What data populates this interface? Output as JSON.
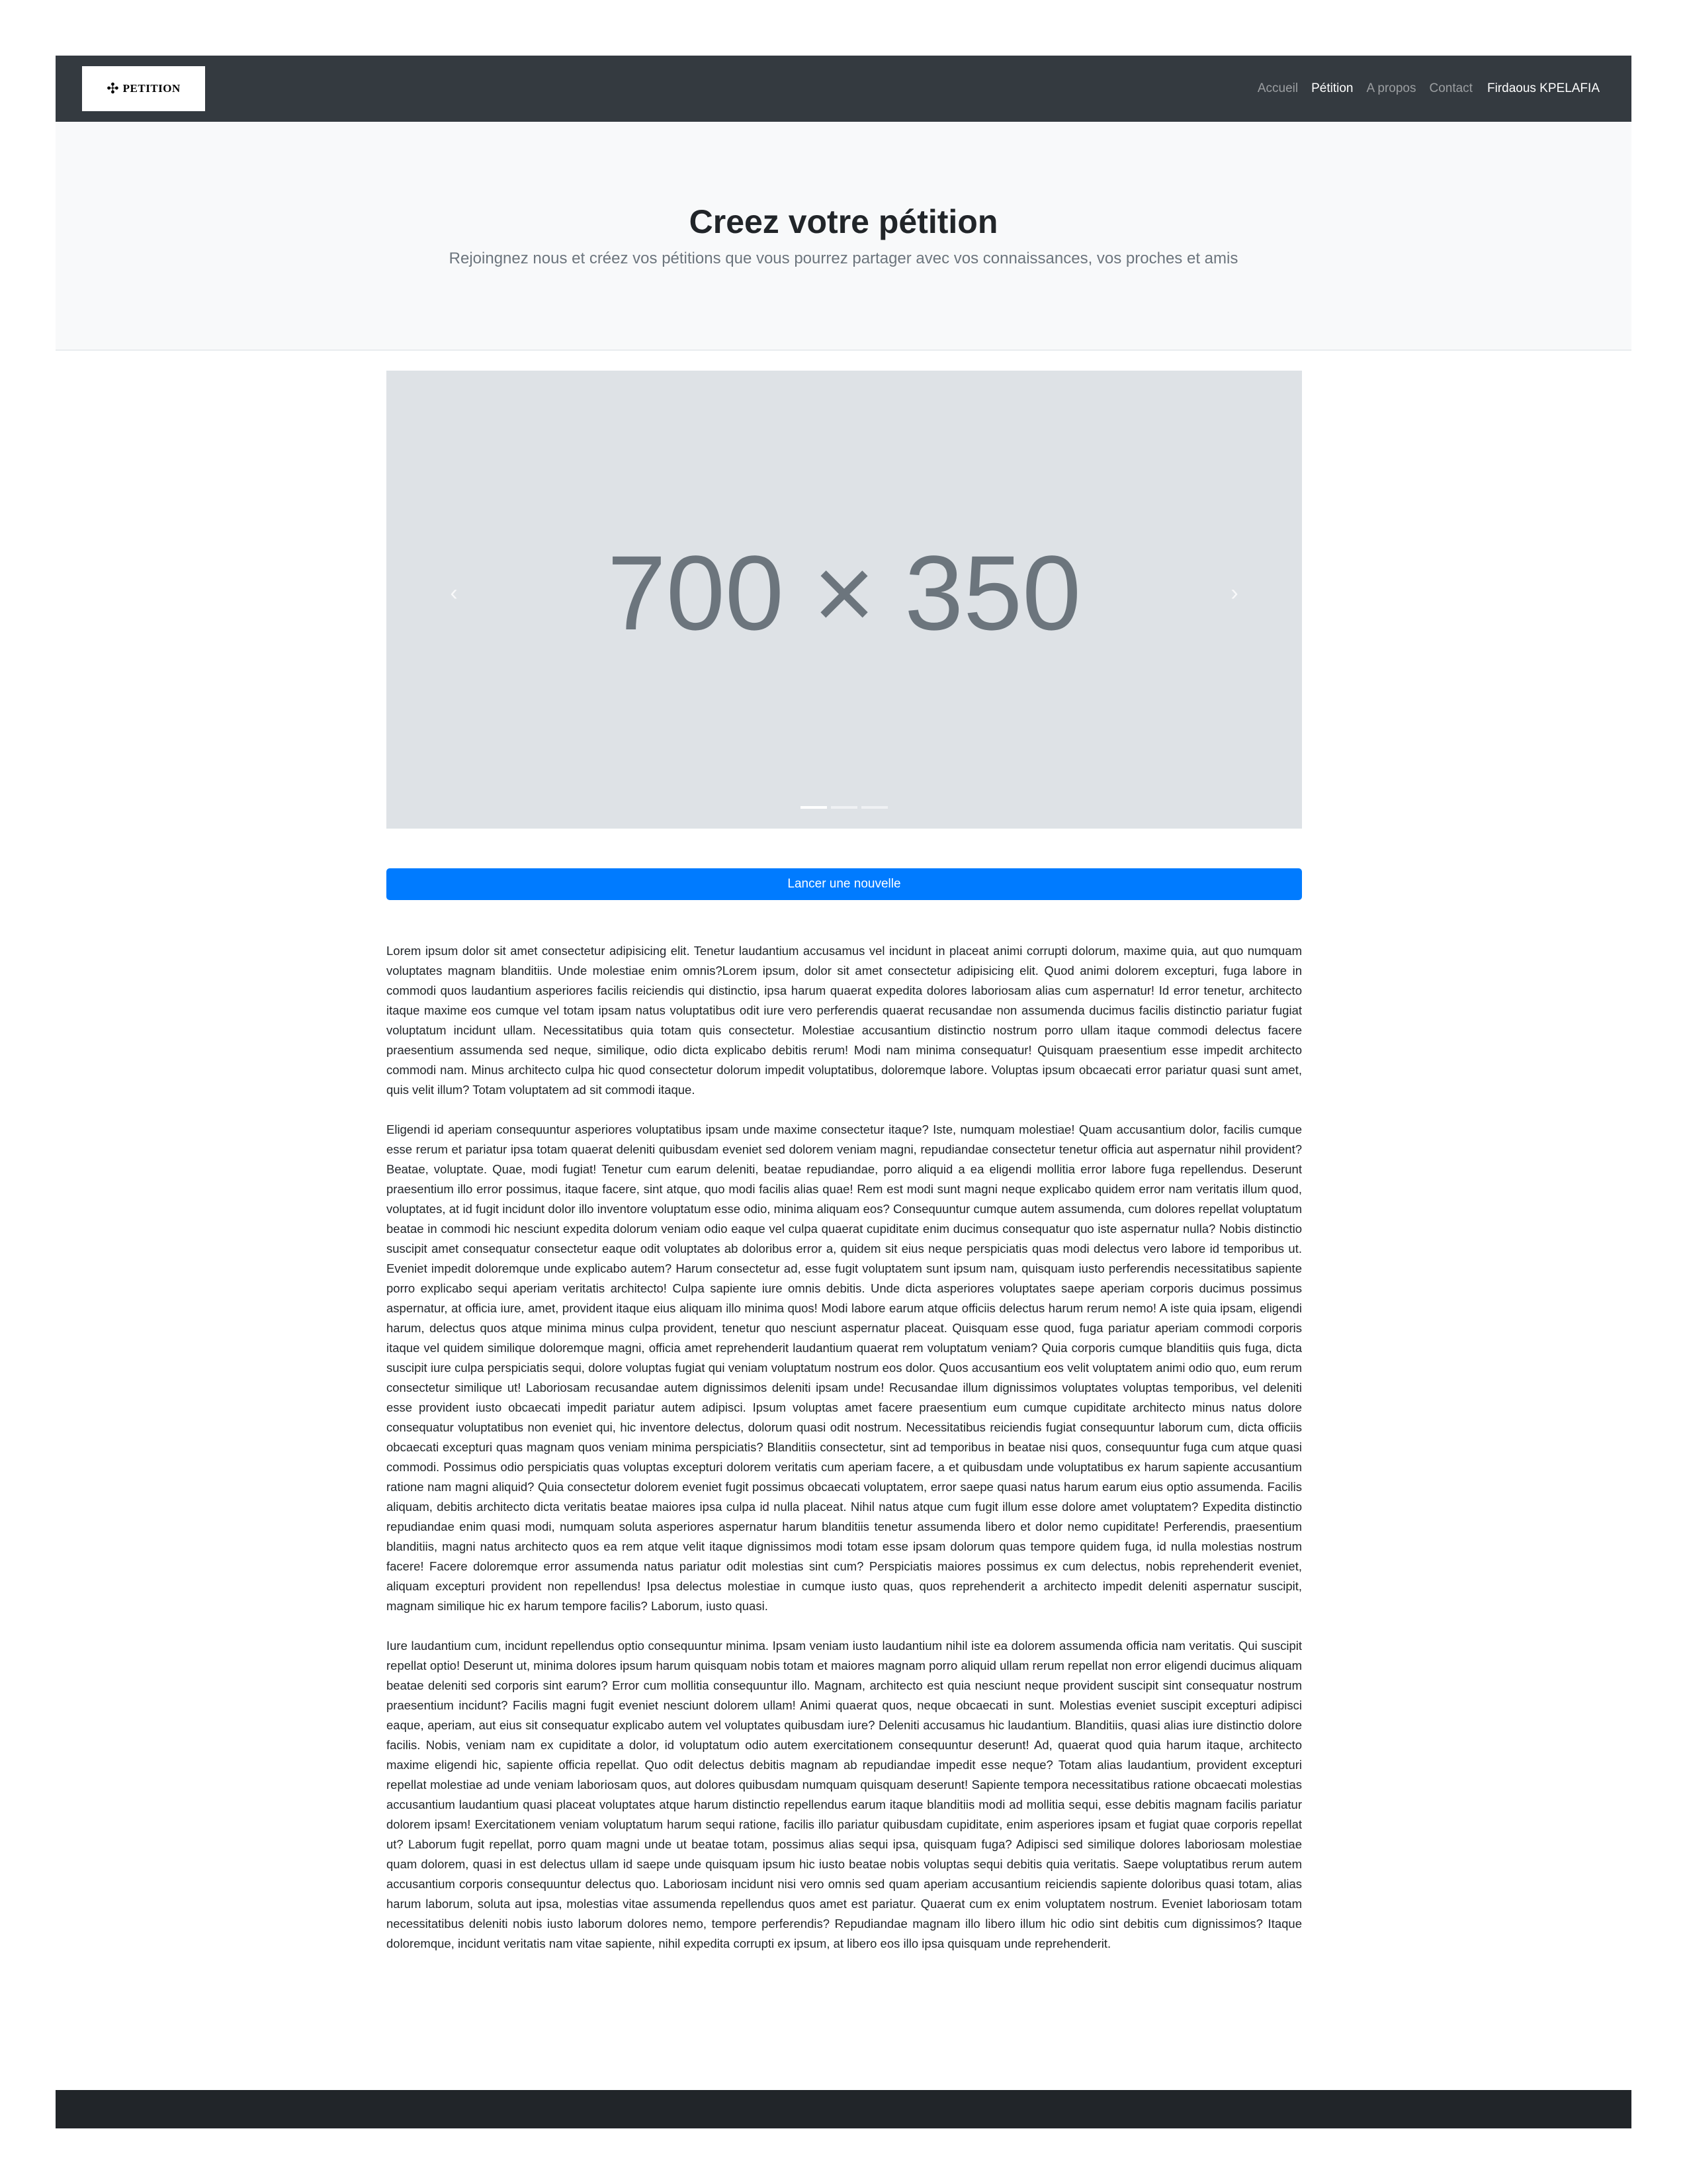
{
  "navbar": {
    "brand": {
      "icon": "four-point-star-icon",
      "text": "PETITION"
    },
    "links": [
      {
        "label": "Accueil",
        "active": false
      },
      {
        "label": "Pétition",
        "active": true
      },
      {
        "label": "A propos",
        "active": false
      },
      {
        "label": "Contact",
        "active": false
      }
    ],
    "user": "Firdaous KPELAFIA"
  },
  "hero": {
    "title": "Creez votre pétition",
    "subtitle": "Rejoingnez nous et créez vos pétitions que vous pourrez partager avec vos connaissances, vos proches et amis"
  },
  "carousel": {
    "placeholder": "700 × 350",
    "prev_icon": "chevron-left-icon",
    "next_icon": "chevron-right-icon",
    "slide_count": 3,
    "active_slide": 1
  },
  "action": {
    "button_label": "Lancer une nouvelle"
  },
  "content": {
    "paragraphs": [
      "Lorem ipsum dolor sit amet consectetur adipisicing elit. Tenetur laudantium accusamus vel incidunt in placeat animi corrupti dolorum, maxime quia, aut quo numquam voluptates magnam blanditiis. Unde molestiae enim omnis?Lorem ipsum, dolor sit amet consectetur adipisicing elit. Quod animi dolorem excepturi, fuga labore in commodi quos laudantium asperiores facilis reiciendis qui distinctio, ipsa harum quaerat expedita dolores laboriosam alias cum aspernatur! Id error tenetur, architecto itaque maxime eos cumque vel totam ipsam natus voluptatibus odit iure vero perferendis quaerat recusandae non assumenda ducimus facilis distinctio pariatur fugiat voluptatum incidunt ullam. Necessitatibus quia totam quis consectetur. Molestiae accusantium distinctio nostrum porro ullam itaque commodi delectus facere praesentium assumenda sed neque, similique, odio dicta explicabo debitis rerum! Modi nam minima consequatur! Quisquam praesentium esse impedit architecto commodi nam. Minus architecto culpa hic quod consectetur dolorum impedit voluptatibus, doloremque labore. Voluptas ipsum obcaecati error pariatur quasi sunt amet, quis velit illum? Totam voluptatem ad sit commodi itaque.",
      "Eligendi id aperiam consequuntur asperiores voluptatibus ipsam unde maxime consectetur itaque? Iste, numquam molestiae! Quam accusantium dolor, facilis cumque esse rerum et pariatur ipsa totam quaerat deleniti quibusdam eveniet sed dolorem veniam magni, repudiandae consectetur tenetur officia aut aspernatur nihil provident? Beatae, voluptate. Quae, modi fugiat! Tenetur cum earum deleniti, beatae repudiandae, porro aliquid a ea eligendi mollitia error labore fuga repellendus. Deserunt praesentium illo error possimus, itaque facere, sint atque, quo modi facilis alias quae! Rem est modi sunt magni neque explicabo quidem error nam veritatis illum quod, voluptates, at id fugit incidunt dolor illo inventore voluptatum esse odio, minima aliquam eos? Consequuntur cumque autem assumenda, cum dolores repellat voluptatum beatae in commodi hic nesciunt expedita dolorum veniam odio eaque vel culpa quaerat cupiditate enim ducimus consequatur quo iste aspernatur nulla? Nobis distinctio suscipit amet consequatur consectetur eaque odit voluptates ab doloribus error a, quidem sit eius neque perspiciatis quas modi delectus vero labore id temporibus ut. Eveniet impedit doloremque unde explicabo autem? Harum consectetur ad, esse fugit voluptatem sunt ipsum nam, quisquam iusto perferendis necessitatibus sapiente porro explicabo sequi aperiam veritatis architecto! Culpa sapiente iure omnis debitis. Unde dicta asperiores voluptates saepe aperiam corporis ducimus possimus aspernatur, at officia iure, amet, provident itaque eius aliquam illo minima quos! Modi labore earum atque officiis delectus harum rerum nemo! A iste quia ipsam, eligendi harum, delectus quos atque minima minus culpa provident, tenetur quo nesciunt aspernatur placeat. Quisquam esse quod, fuga pariatur aperiam commodi corporis itaque vel quidem similique doloremque magni, officia amet reprehenderit laudantium quaerat rem voluptatum veniam? Quia corporis cumque blanditiis quis fuga, dicta suscipit iure culpa perspiciatis sequi, dolore voluptas fugiat qui veniam voluptatum nostrum eos dolor. Quos accusantium eos velit voluptatem animi odio quo, eum rerum consectetur similique ut! Laboriosam recusandae autem dignissimos deleniti ipsam unde! Recusandae illum dignissimos voluptates voluptas temporibus, vel deleniti esse provident iusto obcaecati impedit pariatur autem adipisci. Ipsum voluptas amet facere praesentium eum cumque cupiditate architecto minus natus dolore consequatur voluptatibus non eveniet qui, hic inventore delectus, dolorum quasi odit nostrum. Necessitatibus reiciendis fugiat consequuntur laborum cum, dicta officiis obcaecati excepturi quas magnam quos veniam minima perspiciatis? Blanditiis consectetur, sint ad temporibus in beatae nisi quos, consequuntur fuga cum atque quasi commodi. Possimus odio perspiciatis quas voluptas excepturi dolorem veritatis cum aperiam facere, a et quibusdam unde voluptatibus ex harum sapiente accusantium ratione nam magni aliquid? Quia consectetur dolorem eveniet fugit possimus obcaecati voluptatem, error saepe quasi natus harum earum eius optio assumenda. Facilis aliquam, debitis architecto dicta veritatis beatae maiores ipsa culpa id nulla placeat. Nihil natus atque cum fugit illum esse dolore amet voluptatem? Expedita distinctio repudiandae enim quasi modi, numquam soluta asperiores aspernatur harum blanditiis tenetur assumenda libero et dolor nemo cupiditate! Perferendis, praesentium blanditiis, magni natus architecto quos ea rem atque velit itaque dignissimos modi totam esse ipsam dolorum quas tempore quidem fuga, id nulla molestias nostrum facere! Facere doloremque error assumenda natus pariatur odit molestias sint cum? Perspiciatis maiores possimus ex cum delectus, nobis reprehenderit eveniet, aliquam excepturi provident non repellendus! Ipsa delectus molestiae in cumque iusto quas, quos reprehenderit a architecto impedit deleniti aspernatur suscipit, magnam similique hic ex harum tempore facilis? Laborum, iusto quasi.",
      "Iure laudantium cum, incidunt repellendus optio consequuntur minima. Ipsam veniam iusto laudantium nihil iste ea dolorem assumenda officia nam veritatis. Qui suscipit repellat optio! Deserunt ut, minima dolores ipsum harum quisquam nobis totam et maiores magnam porro aliquid ullam rerum repellat non error eligendi ducimus aliquam beatae deleniti sed corporis sint earum? Error cum mollitia consequuntur illo. Magnam, architecto est quia nesciunt neque provident suscipit sint consequatur nostrum praesentium incidunt? Facilis magni fugit eveniet nesciunt dolorem ullam! Animi quaerat quos, neque obcaecati in sunt. Molestias eveniet suscipit excepturi adipisci eaque, aperiam, aut eius sit consequatur explicabo autem vel voluptates quibusdam iure? Deleniti accusamus hic laudantium. Blanditiis, quasi alias iure distinctio dolore facilis. Nobis, veniam nam ex cupiditate a dolor, id voluptatum odio autem exercitationem consequuntur deserunt! Ad, quaerat quod quia harum itaque, architecto maxime eligendi hic, sapiente officia repellat. Quo odit delectus debitis magnam ab repudiandae impedit esse neque? Totam alias laudantium, provident excepturi repellat molestiae ad unde veniam laboriosam quos, aut dolores quibusdam numquam quisquam deserunt! Sapiente tempora necessitatibus ratione obcaecati molestias accusantium laudantium quasi placeat voluptates atque harum distinctio repellendus earum itaque blanditiis modi ad mollitia sequi, esse debitis magnam facilis pariatur dolorem ipsam! Exercitationem veniam voluptatum harum sequi ratione, facilis illo pariatur quibusdam cupiditate, enim asperiores ipsam et fugiat quae corporis repellat ut? Laborum fugit repellat, porro quam magni unde ut beatae totam, possimus alias sequi ipsa, quisquam fuga? Adipisci sed similique dolores laboriosam molestiae quam dolorem, quasi in est delectus ullam id saepe unde quisquam ipsum hic iusto beatae nobis voluptas sequi debitis quia veritatis. Saepe voluptatibus rerum autem accusantium corporis consequuntur delectus quo. Laboriosam incidunt nisi vero omnis sed quam aperiam accusantium reiciendis sapiente doloribus quasi totam, alias harum laborum, soluta aut ipsa, molestias vitae assumenda repellendus quos amet est pariatur. Quaerat cum ex enim voluptatem nostrum. Eveniet laboriosam totam necessitatibus deleniti nobis iusto laborum dolores nemo, tempore perferendis? Repudiandae magnam illo libero illum hic odio sint debitis cum dignissimos? Itaque doloremque, incidunt veritatis nam vitae sapiente, nihil expedita corrupti ex ipsum, at libero eos illo ipsa quisquam unde reprehenderit."
    ]
  },
  "colors": {
    "navbar_bg": "#343a40",
    "hero_bg": "#f8f9fa",
    "carousel_bg": "#dee2e6",
    "primary": "#007bff",
    "footer_bg": "#212529"
  }
}
